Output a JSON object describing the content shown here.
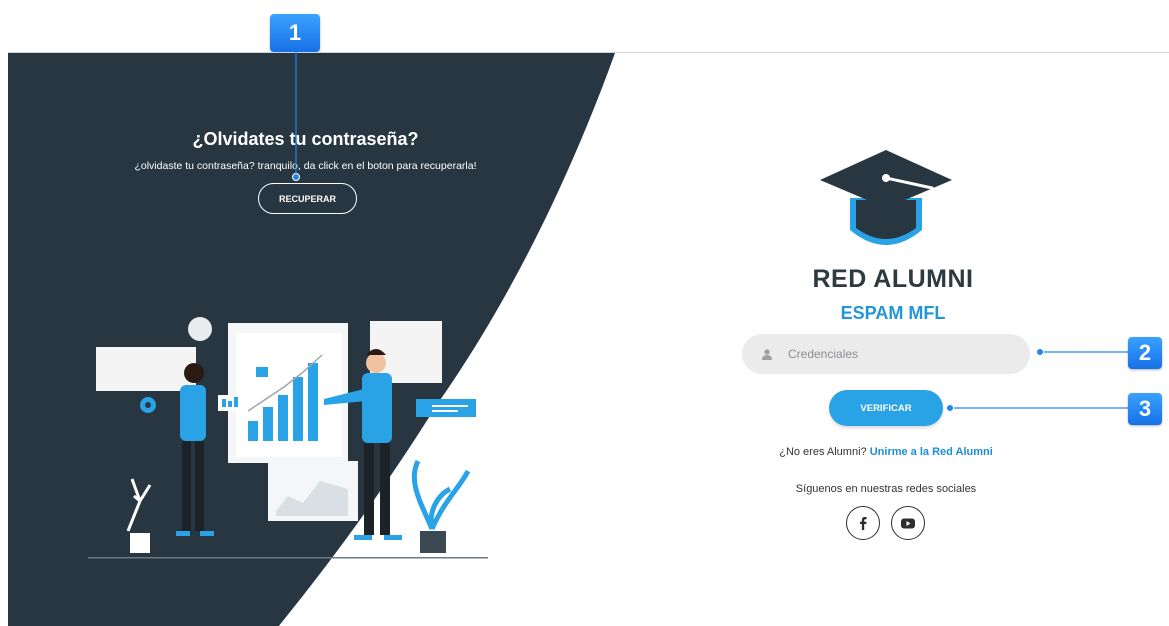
{
  "left_panel": {
    "title": "¿Olvidates tu contraseña?",
    "subtitle": "¿olvidaste tu contraseña? tranquilo, da click en el boton para recuperarla!",
    "recover_button": "RECUPERAR",
    "background_color": "#273640"
  },
  "brand": {
    "title": "RED ALUMNI",
    "subtitle": "ESPAM MFL",
    "logo_icon": "graduation-cap-icon"
  },
  "login": {
    "input_placeholder": "Credenciales",
    "input_icon": "user-icon",
    "verify_button": "VERIFICAR",
    "join_prefix": "¿No eres Alumni?",
    "join_link": "Unirme a la Red Alumni",
    "follow_text": "Síguenos en nuestras redes sociales"
  },
  "social": [
    {
      "name": "facebook",
      "icon": "facebook-icon"
    },
    {
      "name": "youtube",
      "icon": "youtube-icon"
    }
  ],
  "callouts": [
    "1",
    "2",
    "3"
  ],
  "colors": {
    "accent": "#2aa3e6",
    "dark": "#273640",
    "callout": "#1f86f0"
  }
}
